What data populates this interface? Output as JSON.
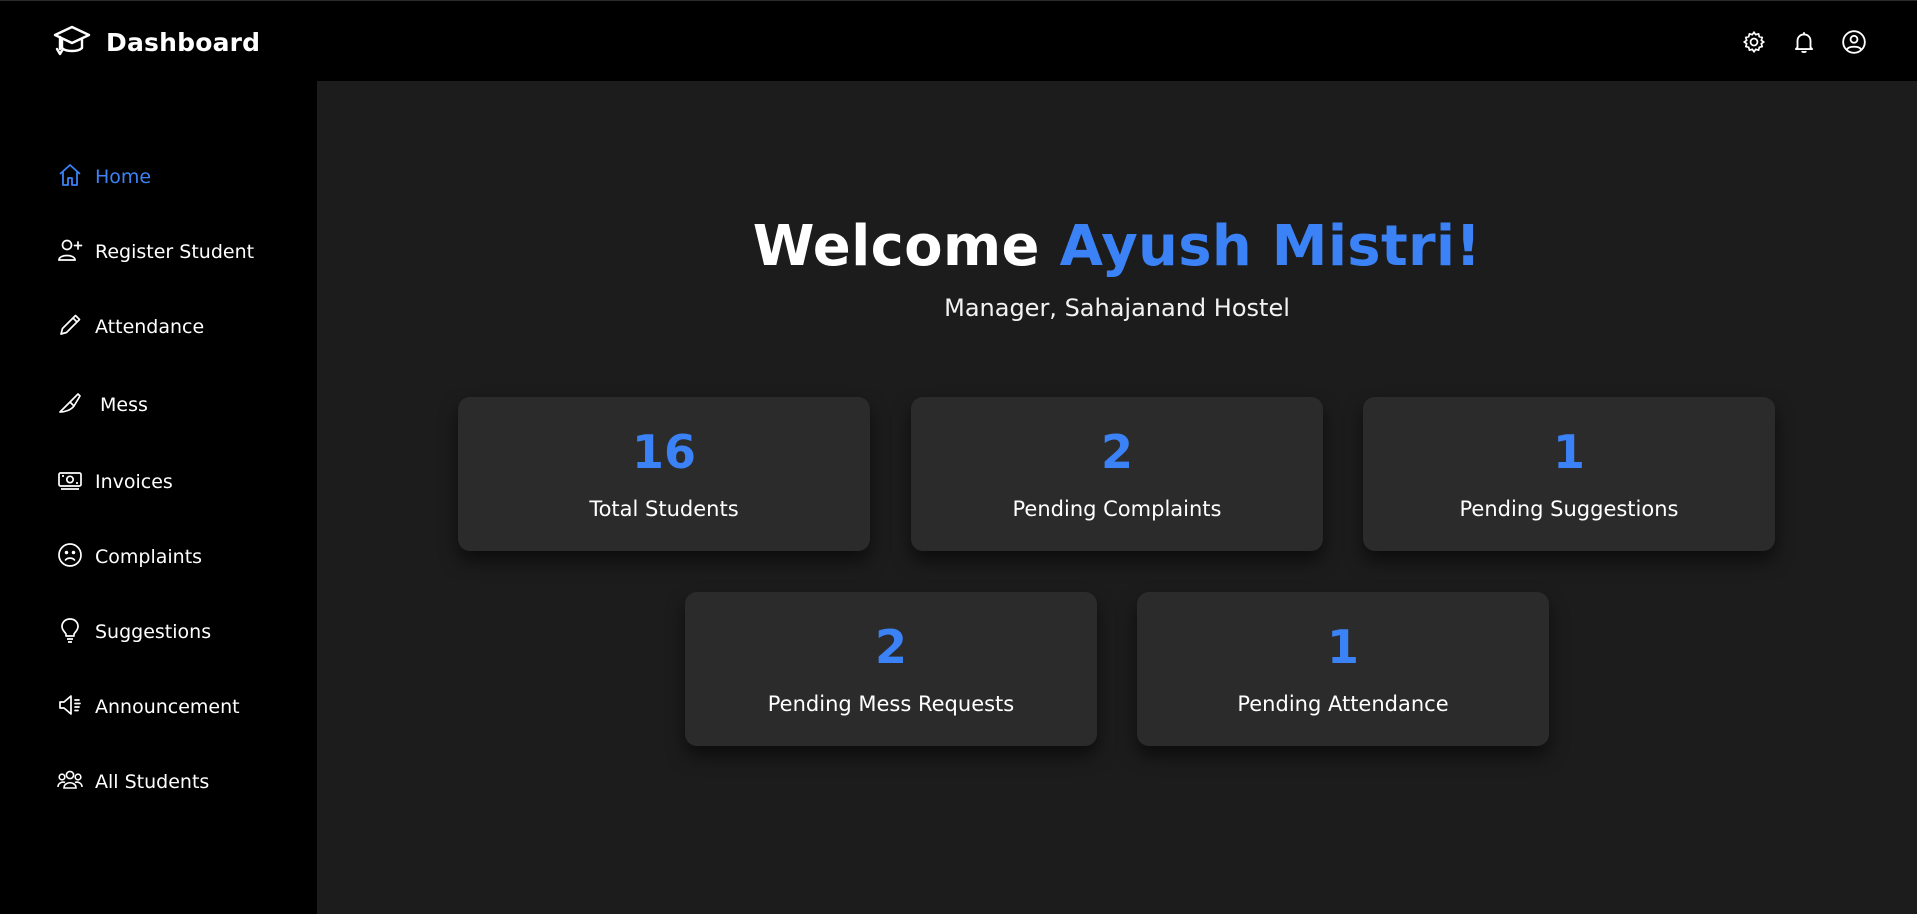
{
  "header": {
    "title": "Dashboard",
    "icons": [
      "graduation-cap-icon",
      "gear-icon",
      "bell-icon",
      "user-circle-icon"
    ]
  },
  "sidebar": {
    "items": [
      {
        "label": "Home",
        "icon": "home-icon",
        "active": true
      },
      {
        "label": "Register Student",
        "icon": "user-plus-icon"
      },
      {
        "label": "Attendance",
        "icon": "pencil-icon"
      },
      {
        "label": "Mess",
        "icon": "knife-icon"
      },
      {
        "label": "Invoices",
        "icon": "cash-icon"
      },
      {
        "label": "Complaints",
        "icon": "sad-face-icon"
      },
      {
        "label": "Suggestions",
        "icon": "lightbulb-icon"
      },
      {
        "label": "Announcement",
        "icon": "megaphone-icon"
      },
      {
        "label": "All Students",
        "icon": "users-icon"
      }
    ]
  },
  "main": {
    "welcome_prefix": "Welcome",
    "user_name": "Ayush Mistri!",
    "subtitle": "Manager, Sahajanand Hostel",
    "cards": [
      {
        "value": "16",
        "label": "Total Students"
      },
      {
        "value": "2",
        "label": "Pending Complaints"
      },
      {
        "value": "1",
        "label": "Pending Suggestions"
      },
      {
        "value": "2",
        "label": "Pending Mess Requests"
      },
      {
        "value": "1",
        "label": "Pending Attendance"
      }
    ]
  },
  "colors": {
    "accent": "#3b82f6",
    "sidebar_bg": "#000000",
    "main_bg": "#1c1c1c",
    "card_bg": "#2b2b2b"
  }
}
